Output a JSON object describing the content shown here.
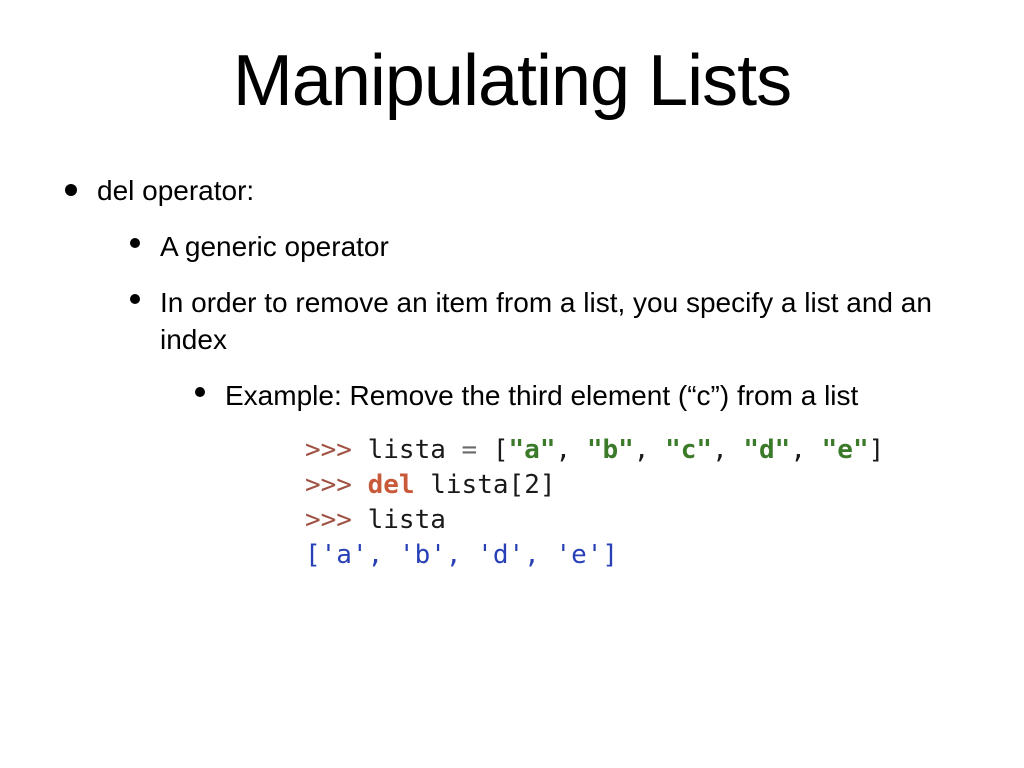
{
  "title": "Manipulating Lists",
  "bullets": {
    "l0": "del operator:",
    "l1a": "A generic operator",
    "l1b": "In order to remove an item from a list, you specify a list and an index",
    "l2": "Example: Remove the third element (“c”) from a list"
  },
  "code": {
    "prompt": ">>>",
    "var": "lista",
    "eq": " = ",
    "lb": "[",
    "rb": "]",
    "comma": ", ",
    "s_a": "\"a\"",
    "s_b": "\"b\"",
    "s_c": "\"c\"",
    "s_d": "\"d\"",
    "s_e": "\"e\"",
    "kw_del": "del",
    "idx_open": "[",
    "idx_num": "2",
    "idx_close": "]",
    "out": "['a', 'b', 'd', 'e']"
  }
}
